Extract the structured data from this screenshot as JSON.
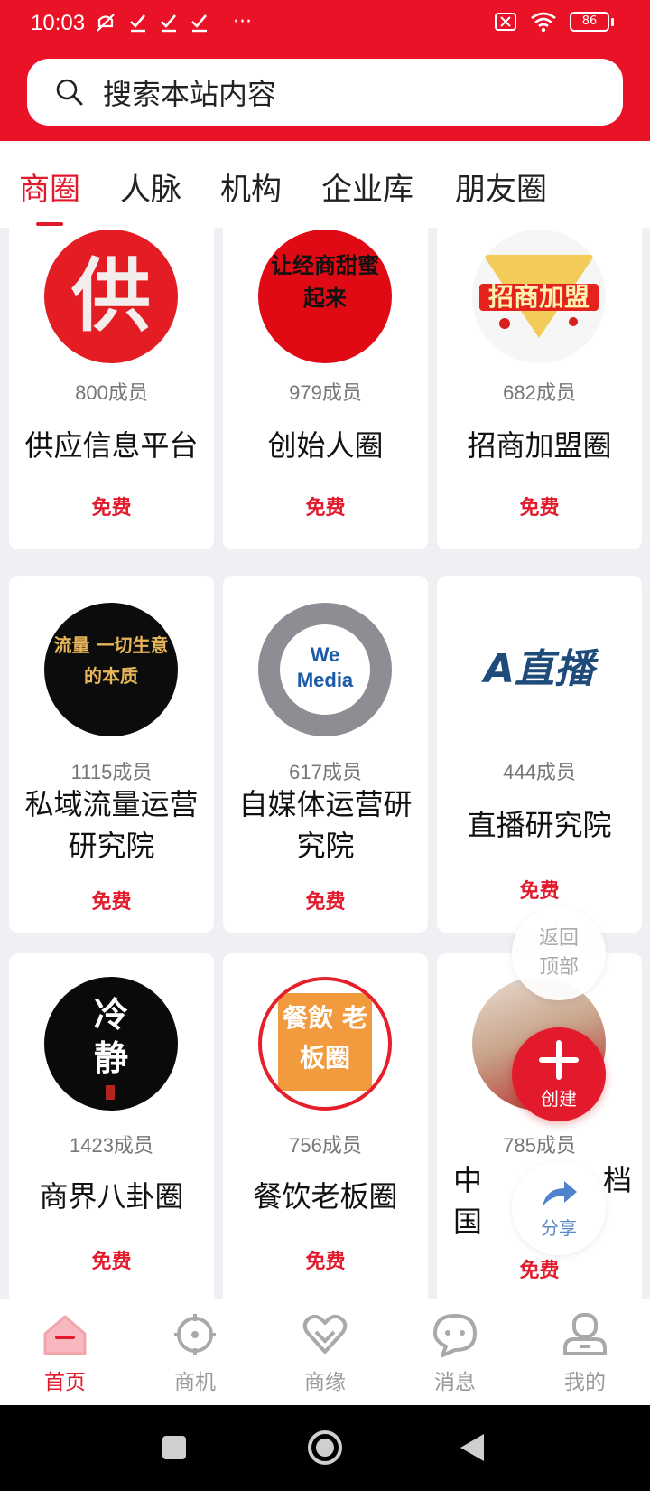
{
  "status_bar": {
    "time": "10:03",
    "left_icons": [
      "mute-icon",
      "check-icon",
      "check-icon",
      "check-icon",
      "more-icon"
    ],
    "more": "···",
    "battery": "86"
  },
  "search": {
    "placeholder": "搜索本站内容"
  },
  "tabs": [
    {
      "label": "商圈",
      "active": true
    },
    {
      "label": "人脉",
      "active": false
    },
    {
      "label": "机构",
      "active": false
    },
    {
      "label": "企业库",
      "active": false
    },
    {
      "label": "朋友圈",
      "active": false
    }
  ],
  "cards": [
    {
      "members": "800成员",
      "name": "供应信息平台",
      "price": "免费",
      "avatar_text": "供"
    },
    {
      "members": "979成员",
      "name": "创始人圈",
      "price": "免费",
      "avatar_text": "让经商甜蜜起来"
    },
    {
      "members": "682成员",
      "name": "招商加盟圈",
      "price": "免费",
      "avatar_text": "招商加盟"
    },
    {
      "members": "1115成员",
      "name": "私域流量运营研究院",
      "price": "免费",
      "avatar_text": "流量 一切生意的本质"
    },
    {
      "members": "617成员",
      "name": "自媒体运营研究院",
      "price": "免费",
      "avatar_text": "We Media"
    },
    {
      "members": "444成员",
      "name": "直播研究院",
      "price": "免费",
      "avatar_text": "A直播"
    },
    {
      "members": "1423成员",
      "name": "商界八卦圈",
      "price": "免费",
      "avatar_text": "冷静"
    },
    {
      "members": "756成员",
      "name": "餐饮老板圈",
      "price": "免费",
      "avatar_text": "餐飲 老板圈"
    },
    {
      "members": "785成员",
      "name": "中国",
      "name_tail": "档",
      "price": "免费",
      "avatar_text": ""
    }
  ],
  "floating": {
    "back_top_line1": "返回",
    "back_top_line2": "顶部",
    "create": "创建",
    "share": "分享"
  },
  "bottom_nav": [
    {
      "label": "首页",
      "icon": "home-icon",
      "active": true
    },
    {
      "label": "商机",
      "icon": "target-icon",
      "active": false
    },
    {
      "label": "商缘",
      "icon": "heart-icon",
      "active": false
    },
    {
      "label": "消息",
      "icon": "chat-icon",
      "active": false
    },
    {
      "label": "我的",
      "icon": "user-icon",
      "active": false
    }
  ],
  "colors": {
    "brand_red": "#ea1226",
    "price_red": "#e21a2c",
    "share_blue": "#5b89c7"
  }
}
